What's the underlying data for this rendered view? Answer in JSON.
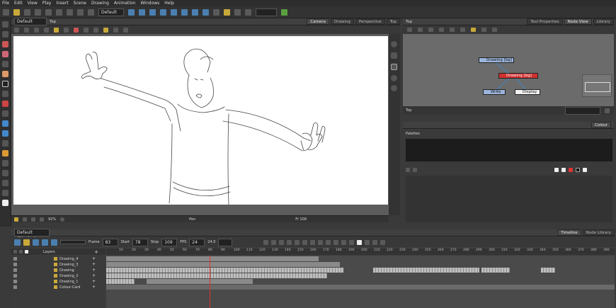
{
  "menu": [
    "File",
    "Edit",
    "View",
    "Play",
    "Insert",
    "Scene",
    "Drawing",
    "Animation",
    "Windows",
    "Help"
  ],
  "toolbar": {
    "workspace": "Default"
  },
  "camera_view": {
    "header_left": "Default (Display)",
    "header_title": "Top",
    "tabs": [
      "Camera",
      "Drawing",
      "Perspective",
      "Top"
    ],
    "active_tab": "Camera",
    "zoom": "92%",
    "status_center": "Pen",
    "status_frame": "Fr 108"
  },
  "node_view": {
    "header_title": "Top",
    "tabs": [
      "Tool Properties",
      "Node View",
      "Library"
    ],
    "active_tab": "Node View",
    "nodes": {
      "drawing": "Drawing [bg]",
      "drawing_sel": "Drawing [bg]",
      "write": "Write",
      "display": "Display"
    },
    "footer_label": "Top"
  },
  "colour_panel": {
    "tab": "Colour",
    "palettes_label": "Palettes"
  },
  "timeline": {
    "display": "Default (Display)",
    "tabs": [
      "Timeline",
      "Node Library"
    ],
    "active_tab": "Timeline",
    "frame_label": "Frame",
    "frame_value": "83",
    "start_label": "Start",
    "start_value": "78",
    "stop_label": "Stop",
    "stop_value": "109",
    "fps_label": "FPS",
    "fps_value": "24",
    "fps_num": "24.0",
    "layers_header": "Layers",
    "layers": [
      "Drawing_4",
      "Drawing_3",
      "Drawing",
      "Drawing_2",
      "Drawing_1",
      "Colour-Card"
    ],
    "ruler": [
      "10",
      "20",
      "30",
      "40",
      "50",
      "60",
      "70",
      "80",
      "90",
      "100",
      "110",
      "120",
      "130",
      "140",
      "150",
      "160",
      "170",
      "180",
      "190",
      "200",
      "210",
      "220",
      "230",
      "240",
      "250",
      "260",
      "270",
      "280",
      "290",
      "300",
      "310",
      "320",
      "330",
      "340",
      "350",
      "360",
      "370",
      "380",
      "390"
    ]
  },
  "colors": {
    "accent_red": "#c0302a",
    "node_selected": "#d03030",
    "node_blue": "#9bb4dc"
  }
}
